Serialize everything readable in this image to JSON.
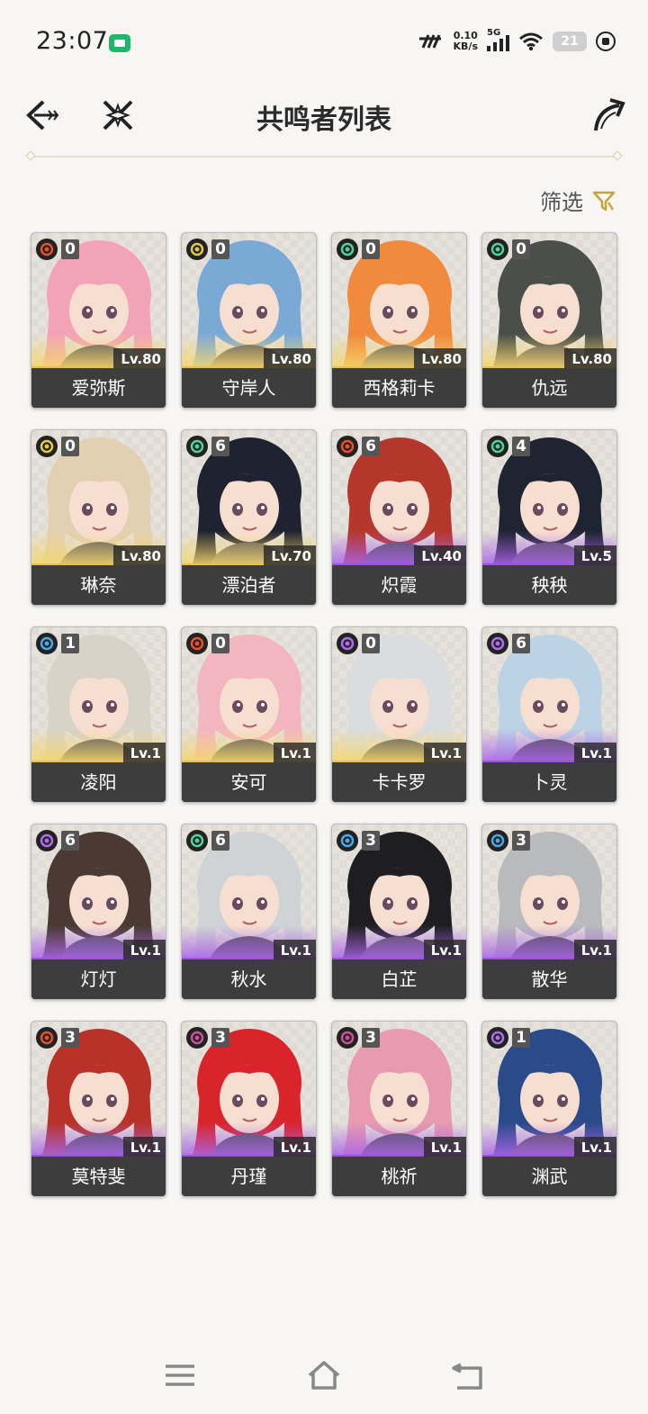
{
  "status_bar": {
    "time": "23:07",
    "net_speed_value": "0.10",
    "net_speed_unit": "KB/s",
    "network": "5G",
    "battery": "21",
    "icons": [
      "app-badge-icon",
      "carrier-icon",
      "signal-icon",
      "wifi-icon",
      "battery-icon",
      "charging-icon"
    ]
  },
  "header": {
    "title": "共鸣者列表",
    "back_icon": "back-arrow-icon",
    "close_icon": "x-close-icon",
    "share_icon": "share-arrow-icon"
  },
  "filter": {
    "label": "筛选",
    "icon": "filter-funnel-icon"
  },
  "colors": {
    "background": "#f7f6f4",
    "five_star": "#e8c04a",
    "four_star": "#9c52e0",
    "name_bar": "#3d3d3d",
    "fusion": "#e8502d",
    "spectro": "#e2c84a",
    "aero": "#4fd199",
    "glacio": "#4aa8e8",
    "electro": "#b06cf0",
    "havoc": "#d04e9c"
  },
  "characters": [
    {
      "name": "爱弥斯",
      "level": "Lv.80",
      "rank": "0",
      "element": "fusion",
      "rarity": 5
    },
    {
      "name": "守岸人",
      "level": "Lv.80",
      "rank": "0",
      "element": "spectro",
      "rarity": 5
    },
    {
      "name": "西格莉卡",
      "level": "Lv.80",
      "rank": "0",
      "element": "aero",
      "rarity": 5
    },
    {
      "name": "仇远",
      "level": "Lv.80",
      "rank": "0",
      "element": "aero",
      "rarity": 5
    },
    {
      "name": "琳奈",
      "level": "Lv.80",
      "rank": "0",
      "element": "spectro",
      "rarity": 5
    },
    {
      "name": "漂泊者",
      "level": "Lv.70",
      "rank": "6",
      "element": "aero",
      "rarity": 5
    },
    {
      "name": "炽霞",
      "level": "Lv.40",
      "rank": "6",
      "element": "fusion",
      "rarity": 4
    },
    {
      "name": "秧秧",
      "level": "Lv.5",
      "rank": "4",
      "element": "aero",
      "rarity": 4
    },
    {
      "name": "凌阳",
      "level": "Lv.1",
      "rank": "1",
      "element": "glacio",
      "rarity": 5
    },
    {
      "name": "安可",
      "level": "Lv.1",
      "rank": "0",
      "element": "fusion",
      "rarity": 5
    },
    {
      "name": "卡卡罗",
      "level": "Lv.1",
      "rank": "0",
      "element": "electro",
      "rarity": 5
    },
    {
      "name": "卜灵",
      "level": "Lv.1",
      "rank": "6",
      "element": "electro",
      "rarity": 4
    },
    {
      "name": "灯灯",
      "level": "Lv.1",
      "rank": "6",
      "element": "electro",
      "rarity": 4
    },
    {
      "name": "秋水",
      "level": "Lv.1",
      "rank": "6",
      "element": "aero",
      "rarity": 4
    },
    {
      "name": "白芷",
      "level": "Lv.1",
      "rank": "3",
      "element": "glacio",
      "rarity": 4
    },
    {
      "name": "散华",
      "level": "Lv.1",
      "rank": "3",
      "element": "glacio",
      "rarity": 4
    },
    {
      "name": "莫特斐",
      "level": "Lv.1",
      "rank": "3",
      "element": "fusion",
      "rarity": 4
    },
    {
      "name": "丹瑾",
      "level": "Lv.1",
      "rank": "3",
      "element": "havoc",
      "rarity": 4
    },
    {
      "name": "桃祈",
      "level": "Lv.1",
      "rank": "3",
      "element": "havoc",
      "rarity": 4
    },
    {
      "name": "渊武",
      "level": "Lv.1",
      "rank": "1",
      "element": "electro",
      "rarity": 4
    }
  ],
  "hair_colors": [
    "#f2a3b5",
    "#7aa9d6",
    "#f08a3c",
    "#4a4f4a",
    "#e3cfb1",
    "#1f2230",
    "#b5372c",
    "#1f2433",
    "#d8d2c8",
    "#f3b6c1",
    "#d9dde0",
    "#bcd3e6",
    "#4a3a33",
    "#cfd3d6",
    "#1e1e22",
    "#b8babd",
    "#b8322a",
    "#d9242b",
    "#e79ab0",
    "#2b4a8a"
  ],
  "navbar": {
    "icons": [
      "menu-icon",
      "home-icon",
      "back-icon"
    ]
  }
}
